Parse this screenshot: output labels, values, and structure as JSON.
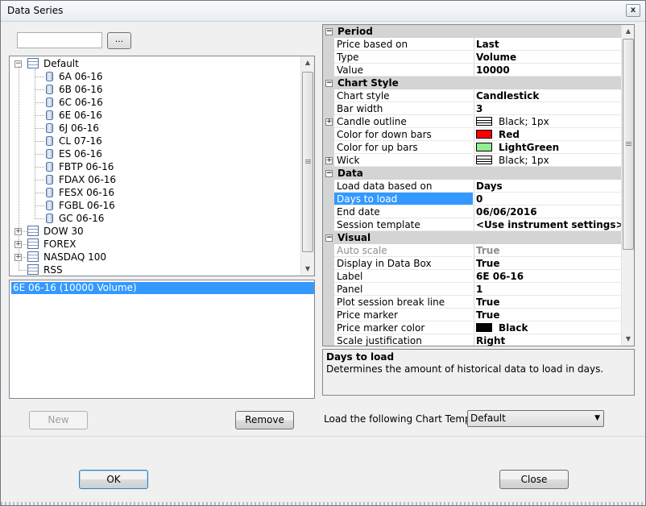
{
  "window": {
    "title": "Data Series",
    "close_glyph": "x"
  },
  "search": {
    "value": "",
    "browse_label": "..."
  },
  "tree": {
    "root": "Default",
    "children": [
      "6A 06-16",
      "6B 06-16",
      "6C 06-16",
      "6E 06-16",
      "6J 06-16",
      "CL 07-16",
      "ES 06-16",
      "FBTP 06-16",
      "FDAX 06-16",
      "FESX 06-16",
      "FGBL 06-16",
      "GC 06-16"
    ],
    "groups": [
      "DOW 30",
      "FOREX",
      "NASDAQ 100",
      "RSS"
    ]
  },
  "series_list": {
    "items": [
      "6E 06-16 (10000 Volume)"
    ]
  },
  "buttons": {
    "new": "New",
    "remove": "Remove",
    "ok": "OK",
    "close": "Close"
  },
  "properties": {
    "rows": [
      {
        "kind": "cat",
        "label": "Period",
        "exp": "−"
      },
      {
        "kind": "prop",
        "name": "Price based on",
        "value": "Last"
      },
      {
        "kind": "prop",
        "name": "Type",
        "value": "Volume"
      },
      {
        "kind": "prop",
        "name": "Value",
        "value": "10000"
      },
      {
        "kind": "cat",
        "label": "Chart Style",
        "exp": "−"
      },
      {
        "kind": "prop",
        "name": "Chart style",
        "value": "Candlestick"
      },
      {
        "kind": "prop",
        "name": "Bar width",
        "value": "3"
      },
      {
        "kind": "prop",
        "name": "Candle outline",
        "value": "Black; 1px",
        "exp": "+",
        "swatch": "#ffffff",
        "swatch_lines": true,
        "normal": true
      },
      {
        "kind": "prop",
        "name": "Color for down bars",
        "value": "Red",
        "swatch": "#ff0000"
      },
      {
        "kind": "prop",
        "name": "Color for up bars",
        "value": "LightGreen",
        "swatch": "#90ee90"
      },
      {
        "kind": "prop",
        "name": "Wick",
        "value": "Black; 1px",
        "exp": "+",
        "swatch": "#ffffff",
        "swatch_lines": true,
        "normal": true
      },
      {
        "kind": "cat",
        "label": "Data",
        "exp": "−"
      },
      {
        "kind": "prop",
        "name": "Load data based on",
        "value": "Days"
      },
      {
        "kind": "prop",
        "name": "Days to load",
        "value": "0",
        "selected": true
      },
      {
        "kind": "prop",
        "name": "End date",
        "value": "06/06/2016"
      },
      {
        "kind": "prop",
        "name": "Session template",
        "value": "<Use instrument settings>"
      },
      {
        "kind": "cat",
        "label": "Visual",
        "exp": "−"
      },
      {
        "kind": "prop",
        "name": "Auto scale",
        "value": "True",
        "disabled": true
      },
      {
        "kind": "prop",
        "name": "Display in Data Box",
        "value": "True"
      },
      {
        "kind": "prop",
        "name": "Label",
        "value": "6E 06-16"
      },
      {
        "kind": "prop",
        "name": "Panel",
        "value": "1"
      },
      {
        "kind": "prop",
        "name": "Plot session break line",
        "value": "True"
      },
      {
        "kind": "prop",
        "name": "Price marker",
        "value": "True"
      },
      {
        "kind": "prop",
        "name": "Price marker color",
        "value": "Black",
        "swatch": "#000000"
      },
      {
        "kind": "prop",
        "name": "Scale justification",
        "value": "Right"
      }
    ]
  },
  "description": {
    "title": "Days to load",
    "text": "Determines the amount of historical data to load in days."
  },
  "template": {
    "label": "Load the following Chart Template:",
    "selected": "Default"
  },
  "colors": {
    "selection": "#3399ff",
    "category_bg": "#d4d4d4"
  }
}
